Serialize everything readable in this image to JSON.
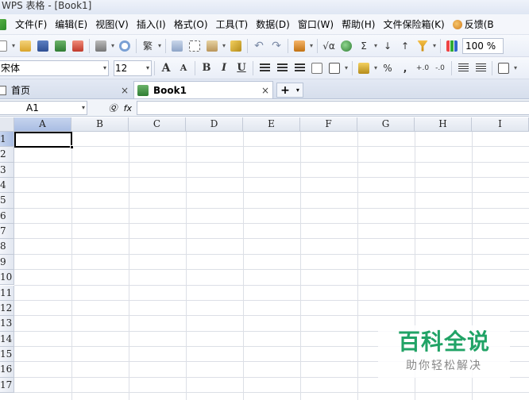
{
  "window": {
    "title": "WPS 表格 - [Book1]"
  },
  "menu": {
    "items": [
      "文件(F)",
      "编辑(E)",
      "视图(V)",
      "插入(I)",
      "格式(O)",
      "工具(T)",
      "数据(D)",
      "窗口(W)",
      "帮助(H)",
      "文件保险箱(K)"
    ],
    "feedback": "反馈(B"
  },
  "toolbar": {
    "traditional_label": "繁",
    "sigma_label": "Σ",
    "sqrt_label": "√α",
    "zoom": "100 %"
  },
  "format": {
    "font_name": "宋体",
    "font_size": "12",
    "grow_label": "A",
    "shrink_label": "A",
    "bold_label": "B",
    "italic_label": "I",
    "underline_label": "U",
    "percent_label": "%",
    "comma_label": ",",
    "inc_decimal_label": "+.0",
    "dec_decimal_label": "-.0"
  },
  "tabs": {
    "home": "首页",
    "active": "Book1",
    "close_glyph": "×",
    "add_glyph": "+"
  },
  "formula": {
    "name_box": "A1",
    "fx_label": "fx",
    "value": ""
  },
  "sheet": {
    "columns": [
      "A",
      "B",
      "C",
      "D",
      "E",
      "F",
      "G",
      "H",
      "I"
    ],
    "rows": [
      "1",
      "2",
      "3",
      "4",
      "5",
      "6",
      "7",
      "8",
      "9",
      "10",
      "11",
      "12",
      "13",
      "14",
      "15",
      "16",
      "17"
    ],
    "active_cell": "A1"
  },
  "watermark": {
    "title": "百科全说",
    "subtitle": "助你轻松解决"
  }
}
